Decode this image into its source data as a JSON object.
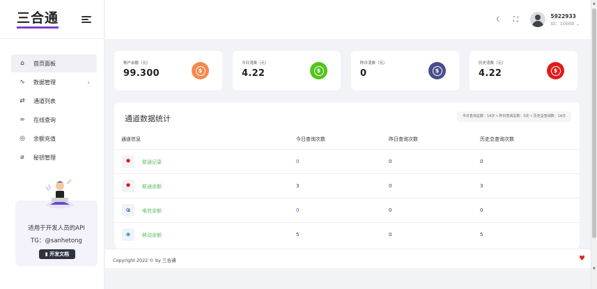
{
  "brand": {
    "logo": "三合通"
  },
  "sidebar": {
    "items": [
      {
        "label": "首页面板",
        "icon": "⌂",
        "icon_name": "home-icon",
        "active": true
      },
      {
        "label": "数据管理",
        "icon": "∿",
        "icon_name": "activity-icon",
        "chevron": "›"
      },
      {
        "label": "通道列表",
        "icon": "⇄",
        "icon_name": "route-icon"
      },
      {
        "label": "在线查询",
        "icon": "∞",
        "icon_name": "link-icon"
      },
      {
        "label": "余额充值",
        "icon": "◎",
        "icon_name": "target-icon"
      },
      {
        "label": "秘钥管理",
        "icon": "⌀",
        "icon_name": "key-icon"
      }
    ]
  },
  "promo": {
    "line1": "适用于开发人员的API",
    "line2": "TG：@sanhetong",
    "button": "开发文档"
  },
  "header": {
    "theme_icon": "☾",
    "fullscreen_icon": "⛶",
    "username": "5922933",
    "user_id": "ID：10000 ⌄"
  },
  "cards": [
    {
      "label": "账户余额（元）",
      "value": "99.300",
      "color": "#f6894a"
    },
    {
      "label": "今日消费（元）",
      "value": "4.22",
      "color": "#52c41a"
    },
    {
      "label": "昨日消费（元）",
      "value": "0",
      "color": "#4a4d8c"
    },
    {
      "label": "历史消费（元）",
      "value": "4.22",
      "color": "#e01a1a"
    }
  ],
  "card_icon_glyph": "$",
  "panel": {
    "title": "通道数据统计",
    "summary": "今日查询总数：14次 • 昨日查询总数：0次 • 历史总查询数：14次",
    "columns": [
      "通道信息",
      "今日查询次数",
      "昨日查询次数",
      "历史总查询次数"
    ],
    "rows": [
      {
        "name": "联通记录",
        "icon": "✹",
        "icon_color": "#e60012",
        "icon_name": "unicom-icon",
        "today": "0",
        "yesterday": "0",
        "total": "0"
      },
      {
        "name": "联通余额",
        "icon": "✹",
        "icon_color": "#e60012",
        "icon_name": "unicom-icon",
        "today": "3",
        "yesterday": "0",
        "total": "3"
      },
      {
        "name": "电信余额",
        "icon": "ҩ",
        "icon_color": "#0053a5",
        "icon_name": "telecom-icon",
        "today": "0",
        "yesterday": "0",
        "total": "0"
      },
      {
        "name": "移动余额",
        "icon": "◈",
        "icon_color": "#0a8fd9",
        "icon_name": "mobile-icon",
        "today": "5",
        "yesterday": "0",
        "total": "5"
      }
    ]
  },
  "footer": {
    "copyright": "Copyright 2022 © by 三合通",
    "heart": "♥"
  }
}
